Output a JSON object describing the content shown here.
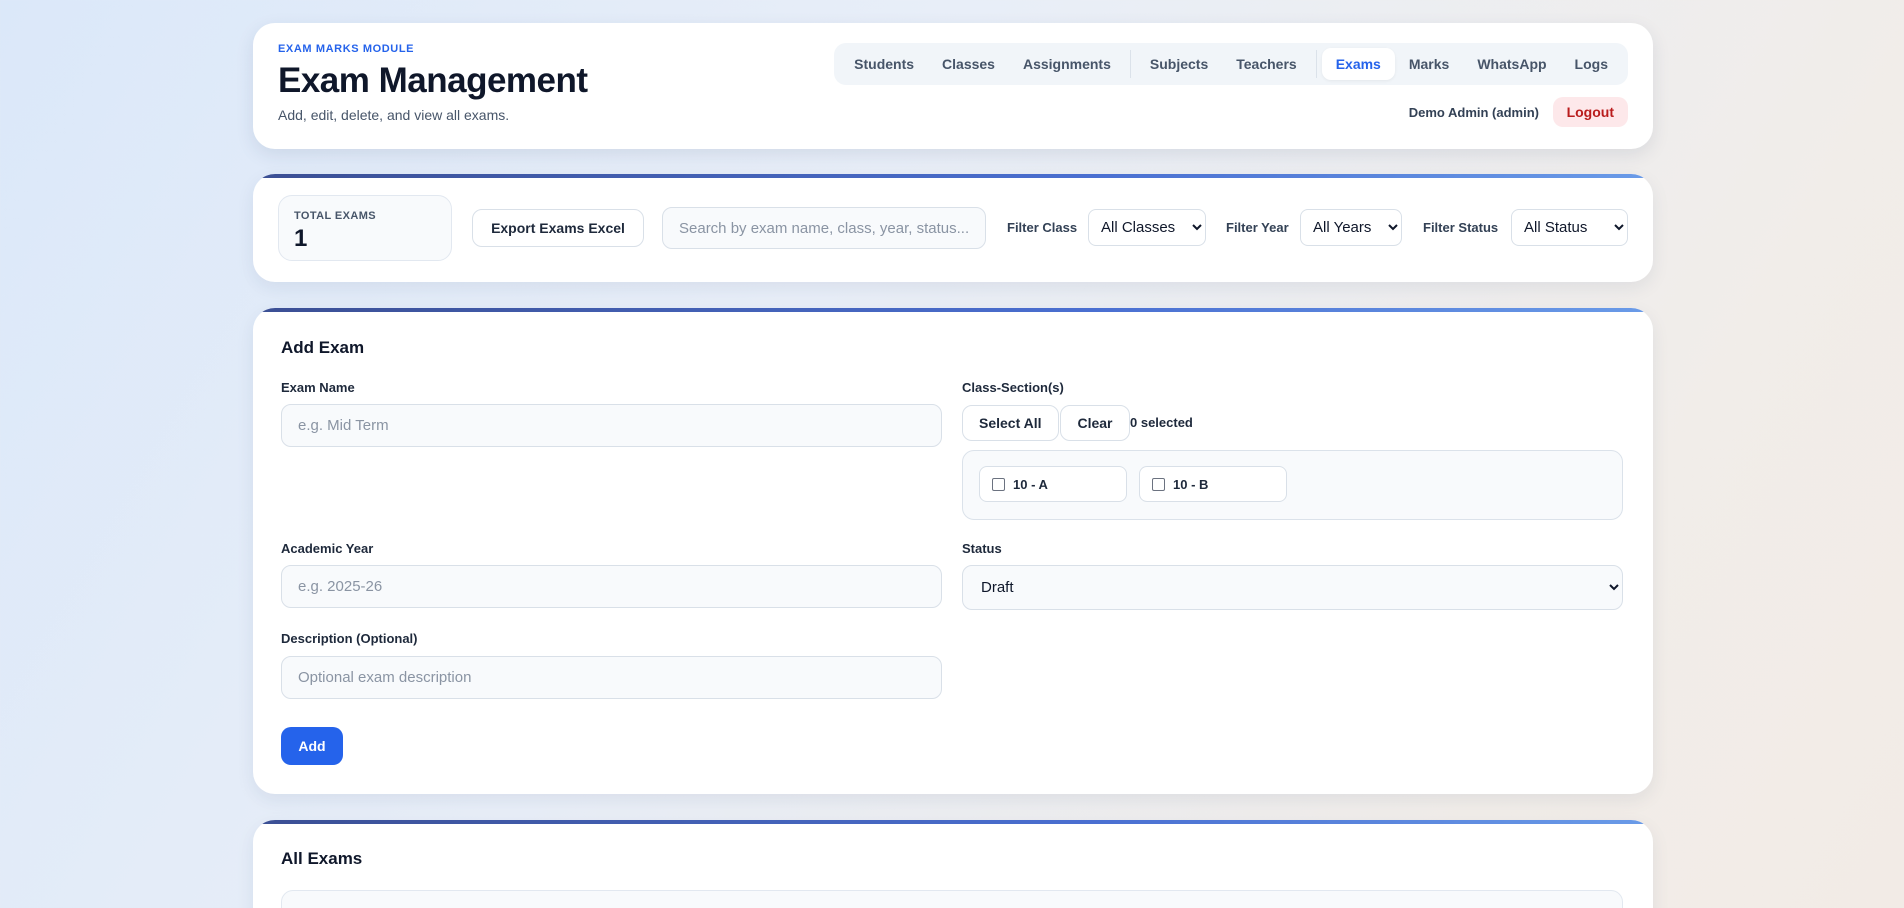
{
  "header": {
    "eyebrow": "EXAM MARKS MODULE",
    "title": "Exam Management",
    "subtitle": "Add, edit, delete, and view all exams.",
    "user": "Demo Admin (admin)",
    "logout_label": "Logout"
  },
  "nav": {
    "items": [
      {
        "label": "Students"
      },
      {
        "label": "Classes"
      },
      {
        "label": "Assignments"
      },
      {
        "label": "Subjects"
      },
      {
        "label": "Teachers"
      },
      {
        "label": "Exams",
        "active": true
      },
      {
        "label": "Marks"
      },
      {
        "label": "WhatsApp"
      },
      {
        "label": "Logs"
      }
    ]
  },
  "toolbar": {
    "total_label": "TOTAL EXAMS",
    "total_value": "1",
    "export_label": "Export Exams Excel",
    "search_placeholder": "Search by exam name, class, year, status...",
    "filter_class_label": "Filter Class",
    "filter_class_value": "All Classes",
    "filter_year_label": "Filter Year",
    "filter_year_value": "All Years",
    "filter_status_label": "Filter Status",
    "filter_status_value": "All Status"
  },
  "form": {
    "title": "Add Exam",
    "exam_name_label": "Exam Name",
    "exam_name_placeholder": "e.g. Mid Term",
    "class_section_label": "Class-Section(s)",
    "select_all_label": "Select All",
    "clear_label": "Clear",
    "selected_count": "0 selected",
    "class_options": [
      {
        "label": "10 - A"
      },
      {
        "label": "10 - B"
      }
    ],
    "academic_year_label": "Academic Year",
    "academic_year_placeholder": "e.g. 2025-26",
    "status_label": "Status",
    "status_value": "Draft",
    "description_label": "Description (Optional)",
    "description_placeholder": "Optional exam description",
    "add_label": "Add"
  },
  "list": {
    "title": "All Exams"
  }
}
